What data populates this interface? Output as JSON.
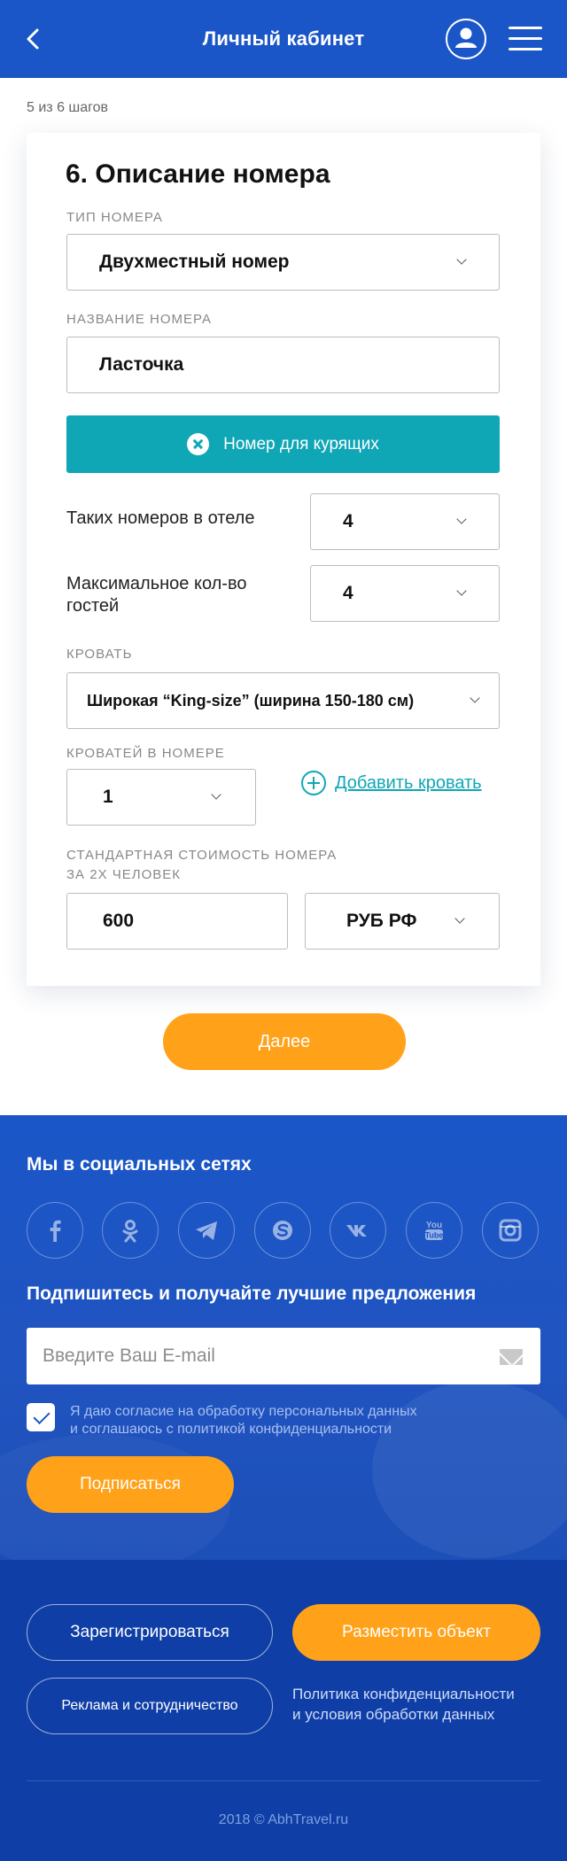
{
  "header": {
    "title": "Личный кабинет"
  },
  "steps": "5 из 6 шагов",
  "card": {
    "title": "6. Описание номера",
    "room_type_label": "ТИП НОМЕРА",
    "room_type_value": "Двухместный номер",
    "room_name_label": "НАЗВАНИЕ НОМЕРА",
    "room_name_value": "Ласточка",
    "smoking_button": "Номер для курящих",
    "rooms_count_label": "Таких номеров в отеле",
    "rooms_count_value": "4",
    "max_guests_label": "Максимальное кол-во гостей",
    "max_guests_value": "4",
    "bed_label": "КРОВАТЬ",
    "bed_value": "Широкая “King-size” (ширина 150-180 см)",
    "beds_count_label": "КРОВАТЕЙ В НОМЕРЕ",
    "beds_count_value": "1",
    "add_bed": "Добавить кровать",
    "price_label_line1": "СТАНДАРТНАЯ СТОИМОСТЬ НОМЕРА",
    "price_label_line2": "ЗА 2Х ЧЕЛОВЕК",
    "price_value": "600",
    "currency_value": "РУБ РФ"
  },
  "next_button": "Далее",
  "social": {
    "title": "Мы в социальных сетях",
    "icons": [
      "facebook-icon",
      "odnoklassniki-icon",
      "telegram-icon",
      "skype-icon",
      "vk-icon",
      "youtube-icon",
      "instagram-icon"
    ],
    "subscribe_title": "Подпишитесь и получайте лучшие предложения",
    "email_placeholder": "Введите Ваш E-mail",
    "consent_line1": "Я даю согласие на обработку персональных данных",
    "consent_line2": "и соглашаюсь с политикой конфиденциальности",
    "subscribe_button": "Подписаться"
  },
  "footer": {
    "register_button": "Зарегистрироваться",
    "place_button": "Разместить объект",
    "ads_button": "Реклама и сотрудничество",
    "policy_line1": "Политика конфиденциальности",
    "policy_line2": "и условия обработки данных",
    "copyright": "2018 © AbhTravel.ru"
  },
  "colors": {
    "primary_blue": "#1a56c8",
    "teal": "#0fa6b6",
    "orange": "#ffa21a",
    "footer_blue": "#0f3fa6"
  }
}
